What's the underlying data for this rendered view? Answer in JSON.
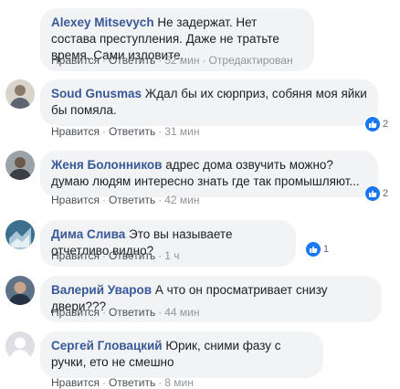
{
  "labels": {
    "like": "Нравится",
    "reply": "Ответить",
    "sep": "·"
  },
  "comments": [
    {
      "author": "Alexey Mitsevych",
      "text": "Не задержат. Нет состава преступления. Даже не тратьте время. Сами изловите.",
      "time": "52 мин",
      "edited": "Отредактирован",
      "likes": ""
    },
    {
      "author": "Soud Gnusmas",
      "text": "Ждал бы их сюрприз, собяня моя яйки бы помяла.",
      "time": "31 мин",
      "likes": "2"
    },
    {
      "author": "Женя Болонников",
      "text": "адрес дома озвучить можно? думаю людям интересно знать где так промышляют...",
      "time": "42 мин",
      "likes": "2"
    },
    {
      "author": "Дима Слива",
      "text": "Это вы называете отчетливо видно?",
      "time": "1 ч",
      "likes": "1"
    },
    {
      "author": "Валерий Уваров",
      "text": "А что он просматривает снизу двери???",
      "time": "44 мин",
      "likes": ""
    },
    {
      "author": "Сергей Гловацкий",
      "text": "Юрик, сними фазу с ручки, ето не смешно",
      "time": "8 мин",
      "likes": ""
    }
  ],
  "colors": {
    "author": "#385898",
    "bubble": "#f2f3f5",
    "meta": "#90949c",
    "like_badge": "#1877f2"
  },
  "icons": {
    "reaction": "thumbs-up-icon"
  }
}
